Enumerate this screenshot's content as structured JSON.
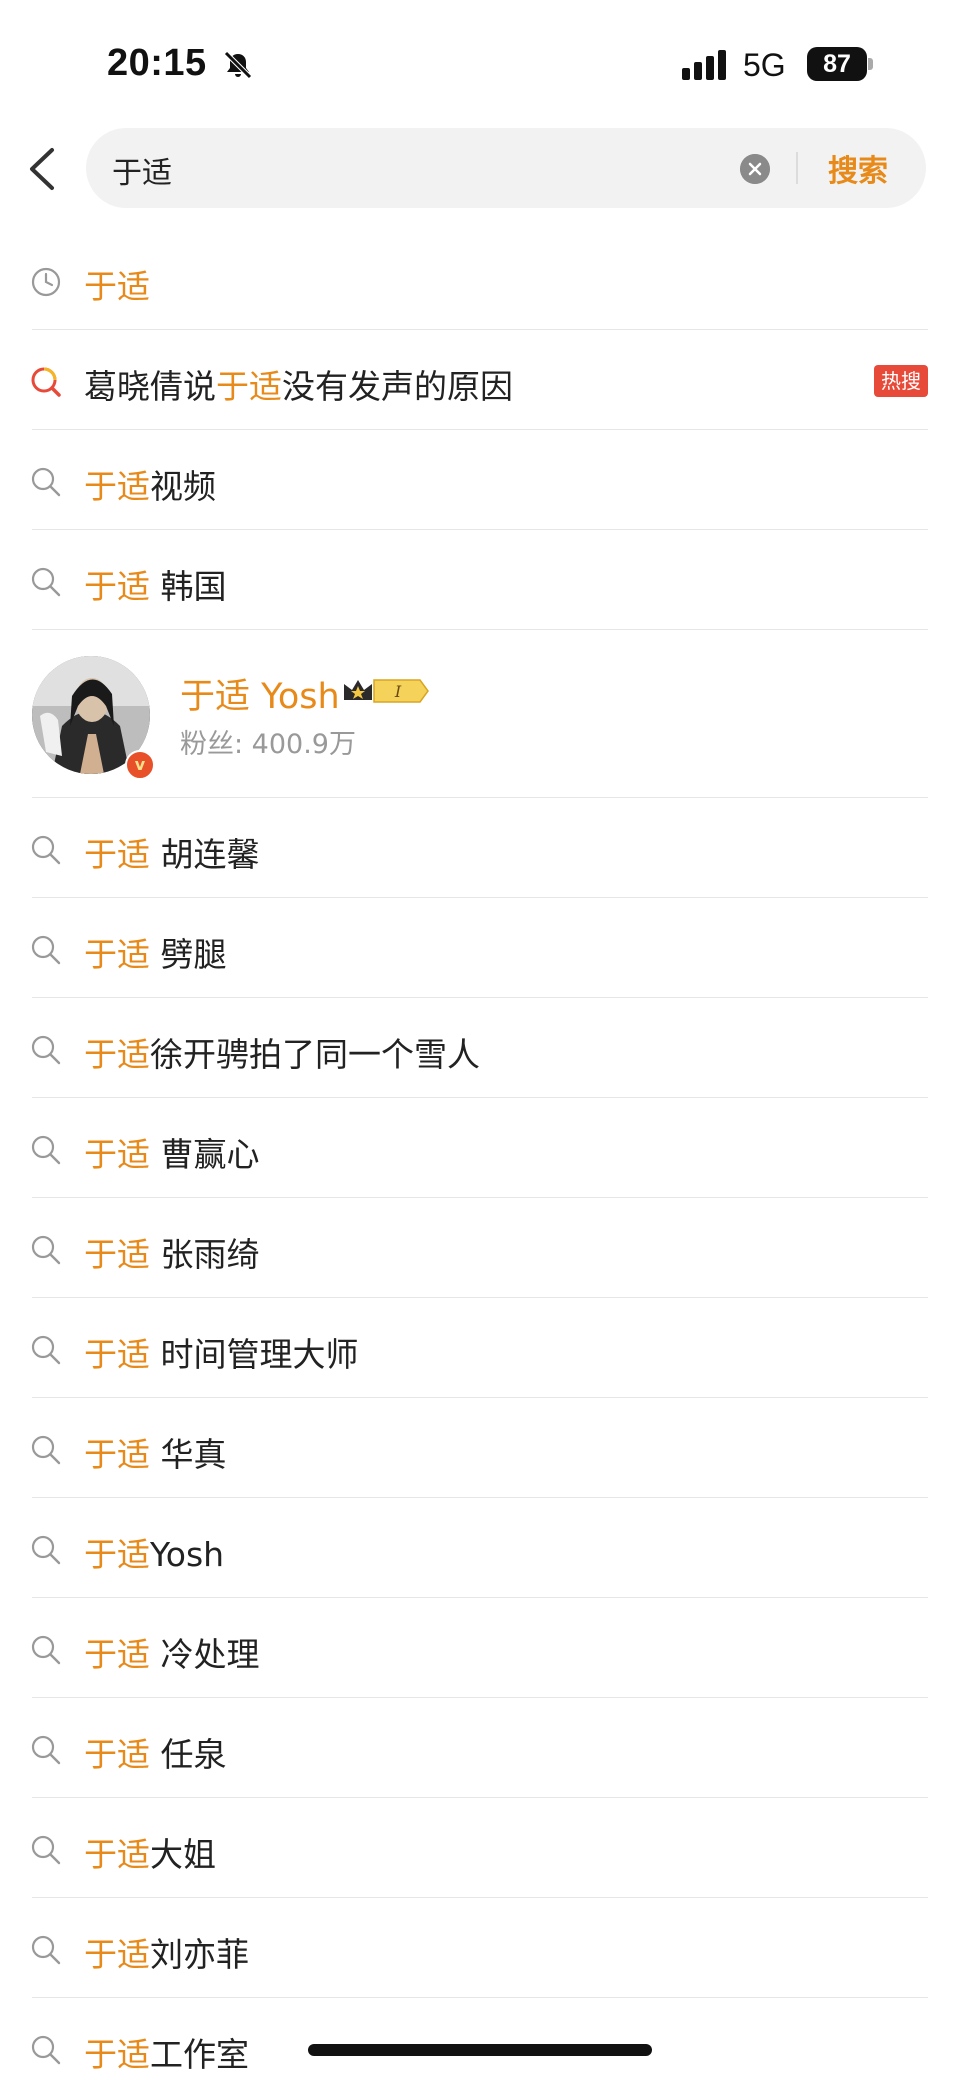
{
  "status_bar": {
    "time": "20:15",
    "network": "5G",
    "battery": "87"
  },
  "search": {
    "query": "于适",
    "button_label": "搜索"
  },
  "items": [
    {
      "icon": "clock-icon",
      "highlight": "于适",
      "rest": "",
      "badge": ""
    },
    {
      "icon": "trending-search-icon",
      "prefix": "葛晓倩说",
      "highlight": "于适",
      "rest": "没有发声的原因",
      "badge": "热搜"
    },
    {
      "icon": "search-icon",
      "highlight": "于适",
      "rest": "视频",
      "badge": ""
    },
    {
      "icon": "search-icon",
      "highlight": "于适",
      "rest": " 韩国",
      "badge": ""
    }
  ],
  "user": {
    "name": "于适 Yosh",
    "fans": "粉丝: 400.9万",
    "level": "I",
    "verified_mark": "v"
  },
  "items2": [
    {
      "icon": "search-icon",
      "highlight": "于适",
      "rest": " 胡连馨"
    },
    {
      "icon": "search-icon",
      "highlight": "于适",
      "rest": " 劈腿"
    },
    {
      "icon": "search-icon",
      "highlight": "于适",
      "rest": "徐开骋拍了同一个雪人"
    },
    {
      "icon": "search-icon",
      "highlight": "于适",
      "rest": " 曹赢心"
    },
    {
      "icon": "search-icon",
      "highlight": "于适",
      "rest": " 张雨绮"
    },
    {
      "icon": "search-icon",
      "highlight": "于适",
      "rest": " 时间管理大师"
    },
    {
      "icon": "search-icon",
      "highlight": "于适",
      "rest": " 华真"
    },
    {
      "icon": "search-icon",
      "highlight": "于适",
      "rest": "Yosh"
    },
    {
      "icon": "search-icon",
      "highlight": "于适",
      "rest": " 冷处理"
    },
    {
      "icon": "search-icon",
      "highlight": "于适",
      "rest": " 任泉"
    },
    {
      "icon": "search-icon",
      "highlight": "于适",
      "rest": "大姐"
    },
    {
      "icon": "search-icon",
      "highlight": "于适",
      "rest": "刘亦菲"
    },
    {
      "icon": "search-icon",
      "highlight": "于适",
      "rest": "工作室"
    }
  ],
  "colors": {
    "accent": "#e88a1a",
    "hot_badge": "#e84a3a"
  }
}
